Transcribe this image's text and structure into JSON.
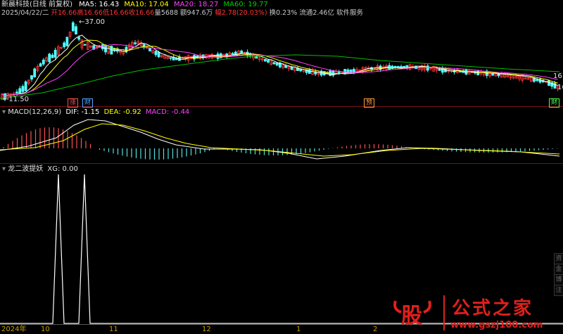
{
  "header": {
    "stock_name": "新晨科技",
    "period": "(日线 前复权)",
    "ma5_label": "MA5: 16.43",
    "ma10_label": "MA10: 17.04",
    "ma20_label": "MA20: 18.27",
    "ma60_label": "MA60: 19.77",
    "date": "2025/04/22/二",
    "open": "开16.66",
    "high": "高16.66",
    "low": "低16.66",
    "close": "收16.66",
    "volume": "量5688",
    "amount": "额947.6万",
    "change": "幅2.78(20.03%)",
    "turnover": "换0.23%",
    "float_cap": "流通2.46亿",
    "sector": "软件服务"
  },
  "price_panel": {
    "high_label": "37.00",
    "low_label": "11.50",
    "right_labels": [
      "16",
      "16"
    ],
    "markers": [
      {
        "text": "涨",
        "color": "#ff5050"
      },
      {
        "text": "财",
        "color": "#50a0ff"
      },
      {
        "text": "预",
        "color": "#ffa040"
      },
      {
        "text": "财",
        "color": "#50a0ff"
      }
    ]
  },
  "macd_panel": {
    "title": "MACD(12,26,9)",
    "dif": "DIF: -1.15",
    "dea": "DEA: -0.92",
    "macd": "MACD: -0.44"
  },
  "signal_panel": {
    "title": "龙二波提妖",
    "xg": "XG: 0.00"
  },
  "time_axis": {
    "labels": [
      "2024年",
      "10",
      "11",
      "12",
      "1",
      "2"
    ]
  },
  "side_buttons": [
    "资",
    "金",
    "博",
    "注"
  ],
  "watermark": {
    "gu": "股",
    "name": "公式之家",
    "url": "www.gszj100.com"
  },
  "colors": {
    "up": "#ff3232",
    "down": "#54ffff",
    "ma5": "#ffffff",
    "ma10": "#ffff00",
    "ma20": "#ff40ff",
    "ma60": "#00c000"
  }
}
